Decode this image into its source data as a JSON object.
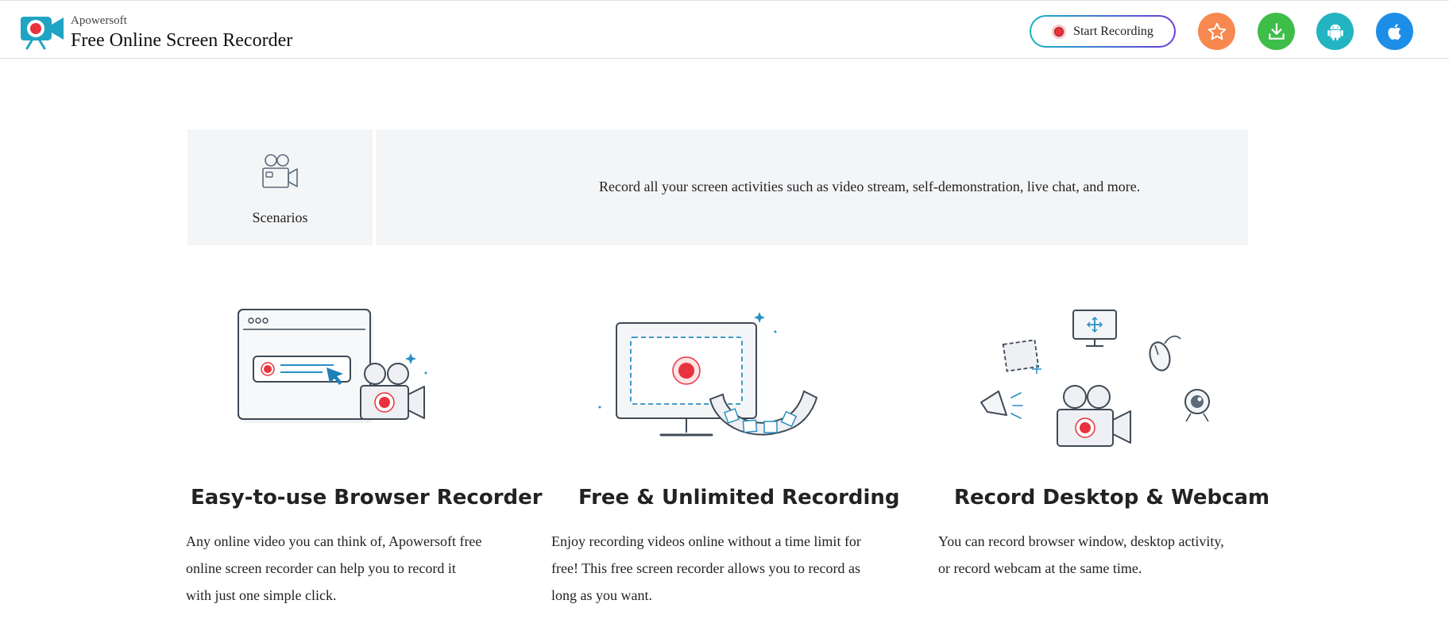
{
  "header": {
    "brand_small": "Apowersoft",
    "brand_title": "Free Online Screen Recorder",
    "start_recording_label": "Start Recording",
    "icons": [
      "app-logo-icon",
      "star-icon",
      "download-icon",
      "android-icon",
      "apple-icon"
    ],
    "colors": {
      "star": "#f7884f",
      "download": "#3fbd49",
      "android": "#23b4c1",
      "apple": "#1d8ee8",
      "record": "#e8323d"
    }
  },
  "scenarios": {
    "label": "Scenarios",
    "text": "Record all your screen activities such as video stream, self-demonstration, live chat, and more."
  },
  "features": [
    {
      "title": "Easy-to-use Browser Recorder",
      "lines": [
        "Any online video you can think of, Apowersoft free",
        "online screen recorder can help you to record it",
        "with just one simple click."
      ]
    },
    {
      "title": "Free & Unlimited Recording",
      "lines": [
        "Enjoy recording videos online without a time limit for",
        "free! This free screen recorder allows you to record as",
        "long as you want."
      ]
    },
    {
      "title": "Record Desktop & Webcam",
      "lines": [
        "You can record browser window, desktop activity,",
        "or record webcam at the same time."
      ]
    }
  ]
}
